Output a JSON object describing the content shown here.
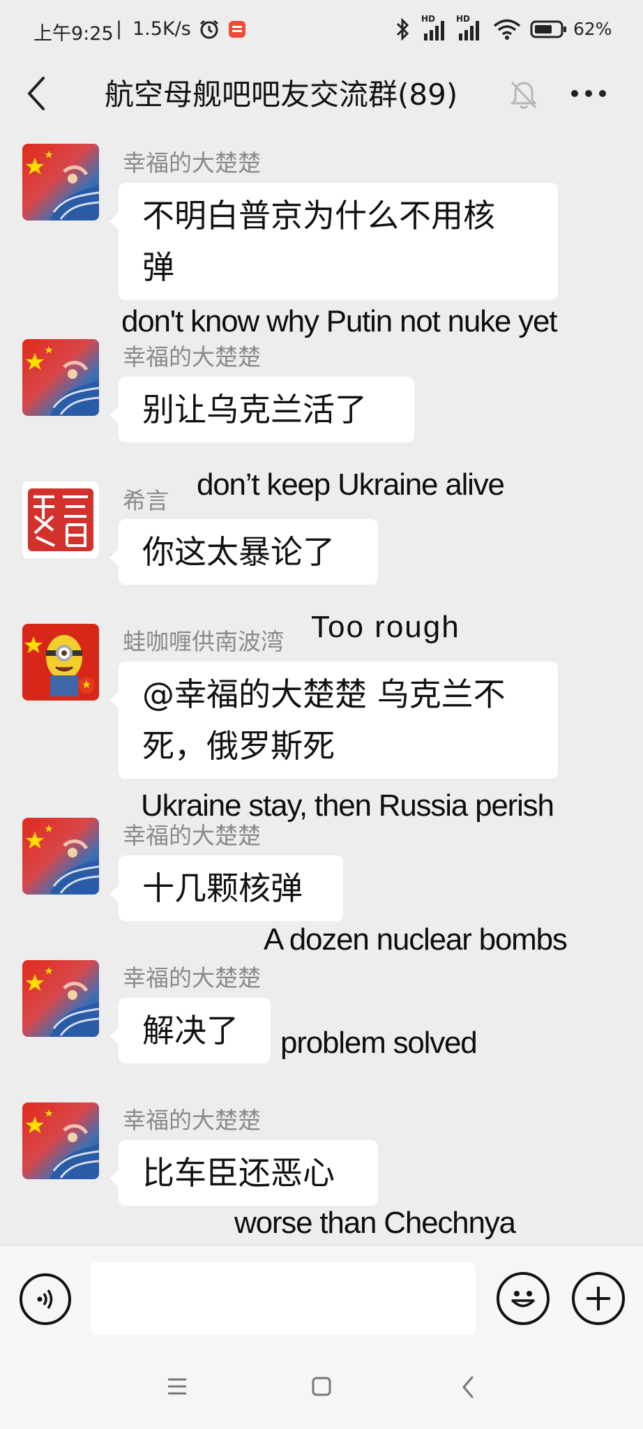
{
  "status_bar": {
    "time": "上午9:25",
    "network_speed": "1.5K/s",
    "hd_label_1": "HD",
    "hd_label_2": "HD",
    "battery": "62%"
  },
  "header": {
    "title": "航空母舰吧吧友交流群(89)"
  },
  "messages": [
    {
      "sender": "幸福的大楚楚",
      "text_line_1": "不明白普京为什么不用核",
      "text_line_2": "弹",
      "caption": "don't know why Putin not nuke yet",
      "avatar": "flag-wave-avatar"
    },
    {
      "sender": "幸福的大楚楚",
      "text_line_1": "别让乌克兰活了",
      "caption": "don’t keep Ukraine alive",
      "avatar": "flag-wave-avatar"
    },
    {
      "sender": "希言",
      "text_line_1": "你这太暴论了",
      "caption": "Too  rough",
      "avatar": "seal-avatar"
    },
    {
      "sender": "蛙咖喱供南波湾",
      "text_line_1": "@幸福的大楚楚  乌克兰不",
      "text_line_2": "死，俄罗斯死",
      "caption": "Ukraine stay, then Russia perish",
      "avatar": "minion-flag-avatar"
    },
    {
      "sender": "幸福的大楚楚",
      "text_line_1": "十几颗核弹",
      "caption": "A dozen nuclear bombs",
      "avatar": "flag-wave-avatar"
    },
    {
      "sender": "幸福的大楚楚",
      "text_line_1": "解决了",
      "caption": "problem solved",
      "avatar": "flag-wave-avatar"
    },
    {
      "sender": "幸福的大楚楚",
      "text_line_1": "比车臣还恶心",
      "caption": "worse than Chechnya",
      "avatar": "flag-wave-avatar"
    }
  ],
  "input_bar": {
    "message_value": "",
    "icons": [
      "voice-icon",
      "emoji-icon",
      "plus-icon"
    ]
  },
  "nav_bar": {
    "icons": [
      "menu-icon",
      "home-icon",
      "back-icon"
    ]
  },
  "colors": {
    "background": "#ededed",
    "bubble": "#ffffff",
    "sender_name": "#8a8a8a",
    "flag_red": "#de2910",
    "flag_star": "#ffde00"
  }
}
